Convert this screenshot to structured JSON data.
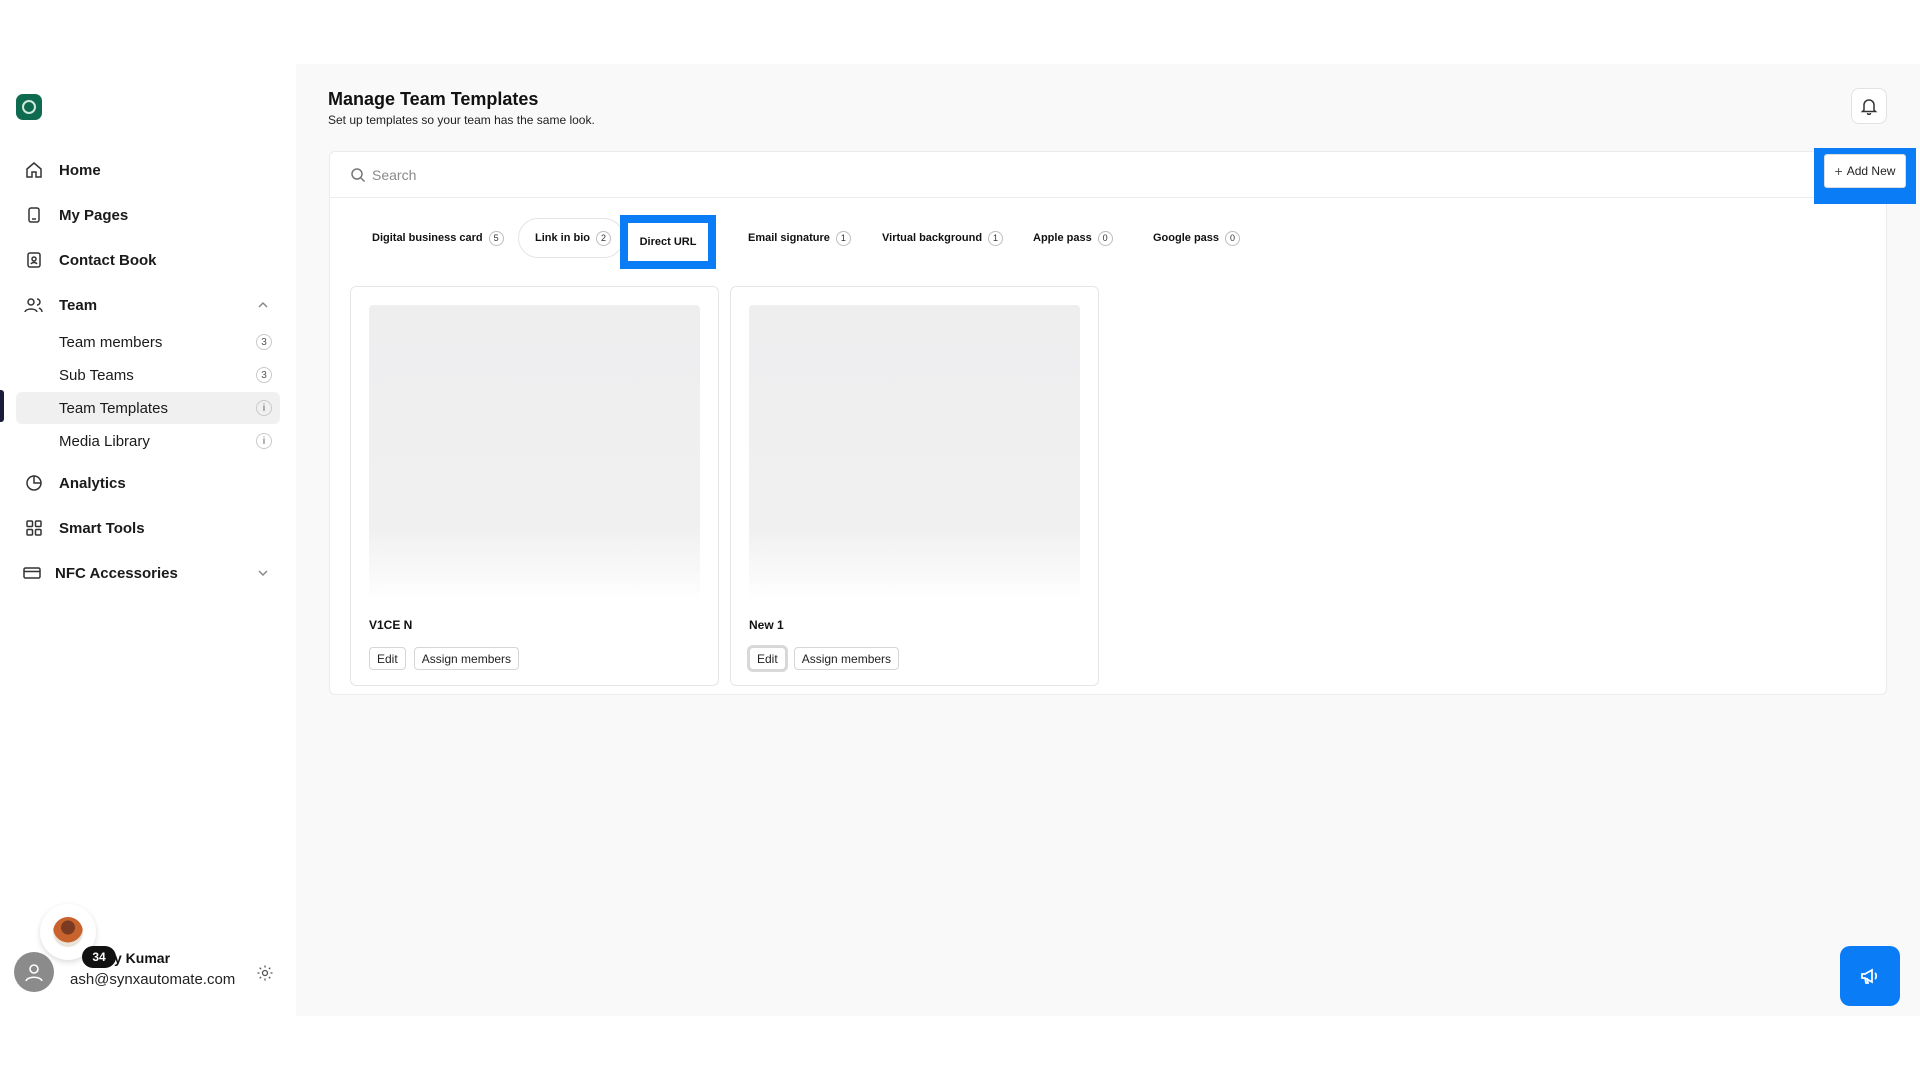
{
  "sidebar": {
    "nav": [
      {
        "label": "Home",
        "icon": "home-icon"
      },
      {
        "label": "My Pages",
        "icon": "pages-icon"
      },
      {
        "label": "Contact Book",
        "icon": "contact-book-icon"
      },
      {
        "label": "Team",
        "icon": "team-icon"
      },
      {
        "label": "Analytics",
        "icon": "analytics-icon"
      },
      {
        "label": "Smart Tools",
        "icon": "grid-icon"
      },
      {
        "label": "NFC Accessories",
        "icon": "card-icon"
      }
    ],
    "team_sub": [
      {
        "label": "Team members",
        "badge": "3"
      },
      {
        "label": "Sub Teams",
        "badge": "3"
      },
      {
        "label": "Team Templates",
        "badge": "i"
      },
      {
        "label": "Media Library",
        "badge": "i"
      }
    ]
  },
  "profile": {
    "notification_count": "34",
    "name": "y Kumar",
    "email": "ash@synxautomate.com"
  },
  "header": {
    "title": "Manage Team Templates",
    "subtitle": "Set up templates so your team has the same look."
  },
  "search": {
    "placeholder": "Search",
    "value": ""
  },
  "add_button_label": "Add New",
  "tabs": [
    {
      "label": "Digital business card",
      "count": "5"
    },
    {
      "label": "Link in bio",
      "count": "2"
    },
    {
      "label": "Direct URL",
      "count": ""
    },
    {
      "label": "Email signature",
      "count": "1"
    },
    {
      "label": "Virtual background",
      "count": "1"
    },
    {
      "label": "Apple pass",
      "count": "0"
    },
    {
      "label": "Google pass",
      "count": "0"
    }
  ],
  "templates": [
    {
      "name": "V1CE N",
      "edit_label": "Edit",
      "assign_label": "Assign members"
    },
    {
      "name": "New 1",
      "edit_label": "Edit",
      "assign_label": "Assign members"
    }
  ],
  "colors": {
    "accent": "#0a7cf5",
    "logo": "#0f6b4f",
    "active_bar": "#1b1b3a"
  }
}
